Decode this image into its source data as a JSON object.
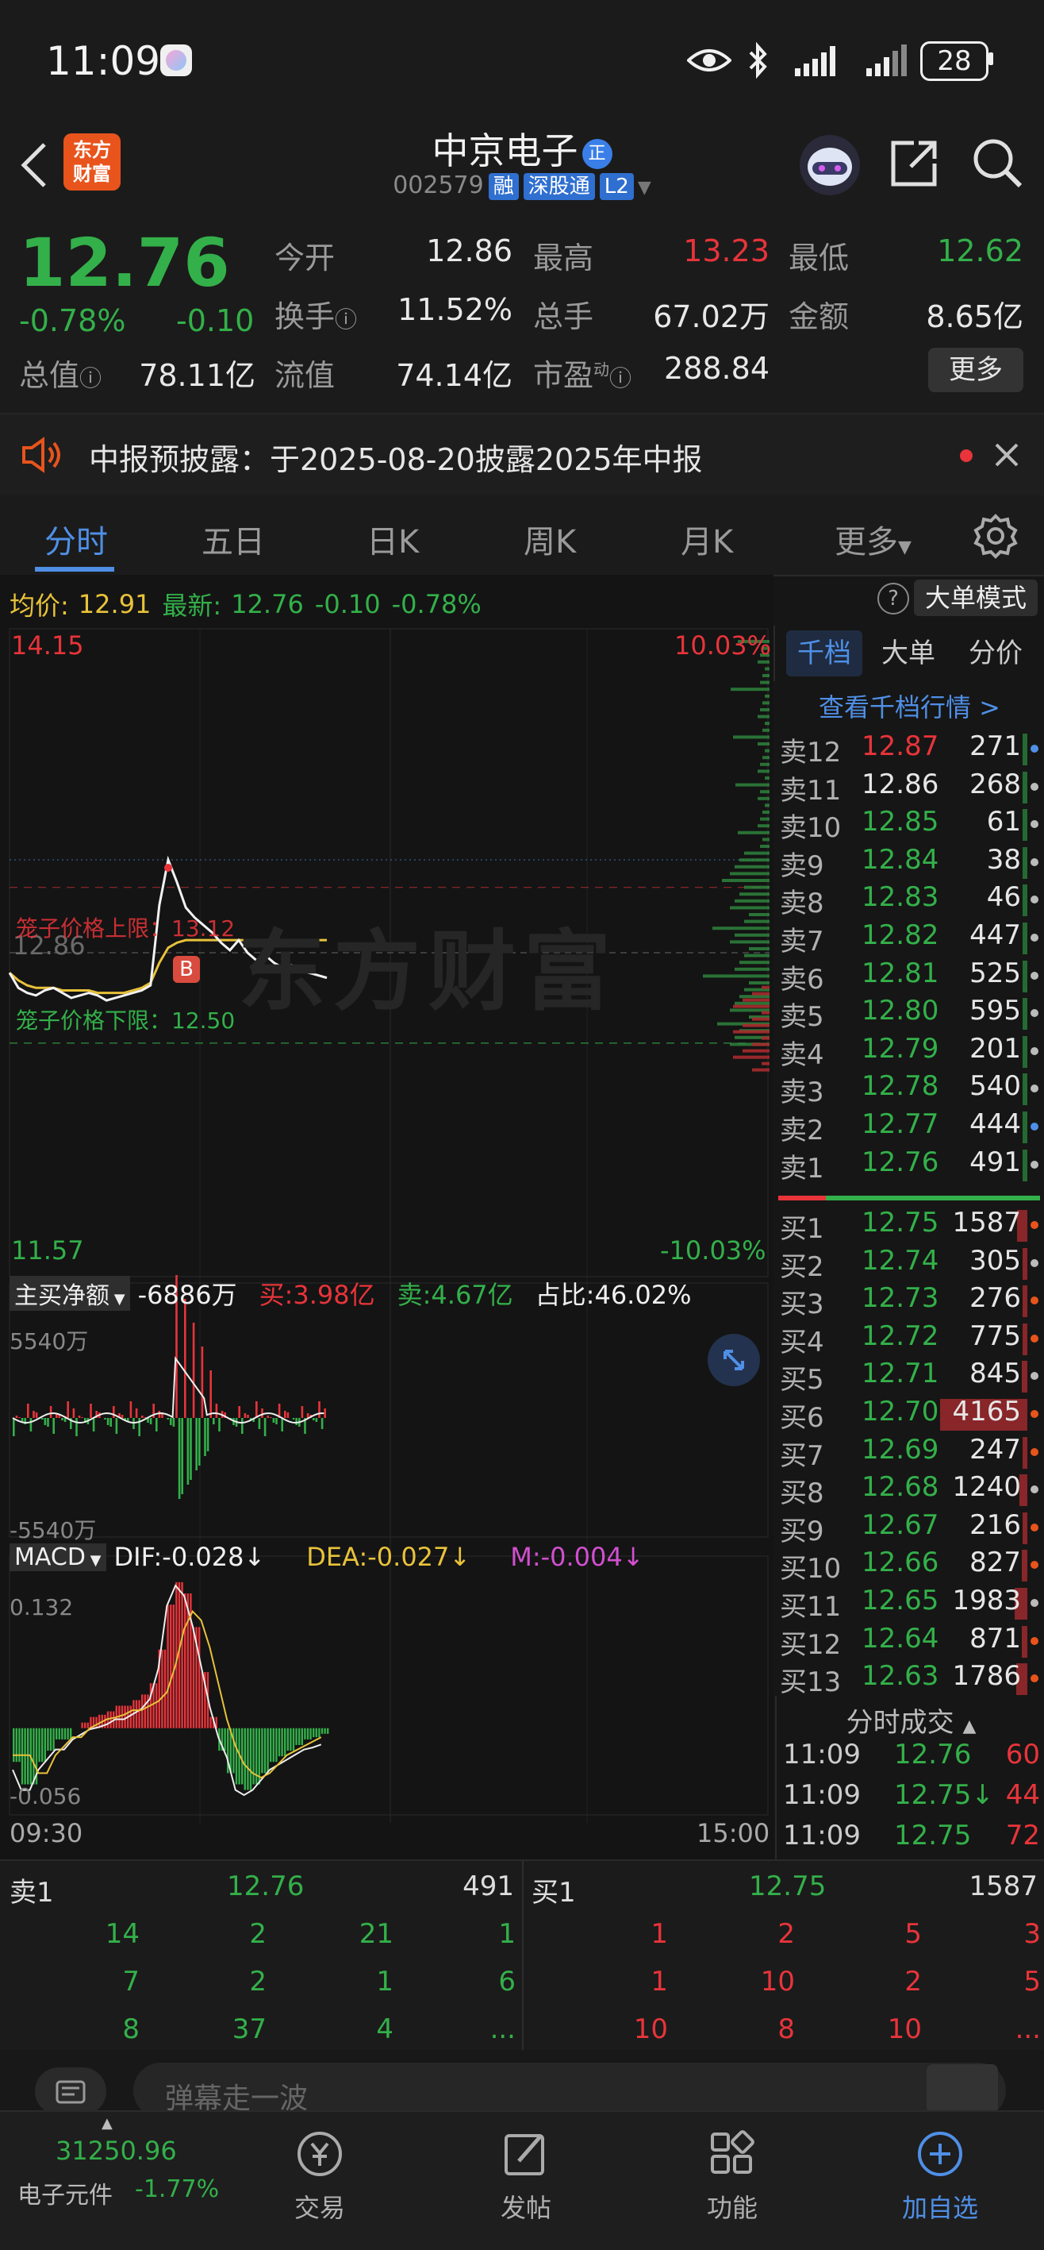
{
  "status": {
    "time": "11:09",
    "battery": "28"
  },
  "header": {
    "stock_name": "中京电子",
    "name_badge": "正",
    "code": "002579",
    "tags": [
      "融",
      "深股通",
      "L2"
    ],
    "logo_text_1": "东方",
    "logo_text_2": "财富"
  },
  "quote": {
    "price": "12.76",
    "change_pct": "-0.78%",
    "change": "-0.10",
    "open_label": "今开",
    "open": "12.86",
    "high_label": "最高",
    "high": "13.23",
    "low_label": "最低",
    "low": "12.62",
    "turnover_label": "换手",
    "turnover": "11.52%",
    "volume_label": "总手",
    "volume": "67.02万",
    "amount_label": "金额",
    "amount": "8.65亿",
    "mktcap_label": "总值",
    "mktcap": "78.11亿",
    "float_label": "流值",
    "float": "74.14亿",
    "pe_label": "市盈",
    "pe_sup": "动",
    "pe": "288.84",
    "more_button": "更多"
  },
  "notice": {
    "text": "中报预披露：于2025-08-20披露2025年中报"
  },
  "tabs": [
    "分时",
    "五日",
    "日K",
    "周K",
    "月K",
    "更多"
  ],
  "chart_header": {
    "avg_label": "均价:",
    "avg": "12.91",
    "latest_label": "最新:",
    "latest": "12.76",
    "chg": "-0.10",
    "pct": "-0.78%",
    "mode_button": "大单模式"
  },
  "chart_data": {
    "type": "line",
    "price_axis": {
      "top": "14.15",
      "bottom": "11.57",
      "top_pct": "10.03%",
      "bottom_pct": "-10.03%",
      "prev_close": "12.86"
    },
    "upper_limit_label": "笼子价格上限：13.12",
    "lower_limit_label": "笼子价格下限：12.50",
    "upper_limit": 13.12,
    "lower_limit": 12.5,
    "time_start": "09:30",
    "time_end": "15:00",
    "watermark": "东方财富",
    "price_series": [
      12.78,
      12.72,
      12.7,
      12.69,
      12.71,
      12.72,
      12.7,
      12.68,
      12.69,
      12.7,
      12.69,
      12.67,
      12.68,
      12.69,
      12.7,
      12.71,
      12.73,
      13.05,
      13.23,
      13.14,
      13.04,
      13.0,
      12.97,
      12.94,
      12.9,
      12.87,
      12.91,
      12.86,
      12.83,
      12.85,
      12.82,
      12.8,
      12.81,
      12.79,
      12.78,
      12.77,
      12.76
    ],
    "avg_series": [
      12.78,
      12.75,
      12.73,
      12.72,
      12.72,
      12.72,
      12.71,
      12.71,
      12.71,
      12.71,
      12.7,
      12.7,
      12.7,
      12.7,
      12.71,
      12.72,
      12.74,
      12.82,
      12.88,
      12.9,
      12.91,
      12.91,
      12.91,
      12.91,
      12.91,
      12.91,
      12.91,
      12.91,
      12.91,
      12.91,
      12.91,
      12.91,
      12.91,
      12.91,
      12.91,
      12.91,
      12.91
    ],
    "flow": {
      "label": "主买净额",
      "net": "-6886万",
      "buy": "买:3.98亿",
      "sell": "卖:4.67亿",
      "ratio": "占比:46.02%",
      "top": "5540万",
      "bottom": "-5540万"
    },
    "macd": {
      "label": "MACD",
      "dif": "DIF:-0.028↓",
      "dea": "DEA:-0.027↓",
      "m": "M:-0.004↓",
      "top": "0.132",
      "bottom": "-0.056"
    },
    "macd_hist": [
      -0.03,
      -0.05,
      -0.05,
      -0.03,
      -0.02,
      -0.01,
      -0.01,
      0.0,
      0.005,
      0.01,
      0.012,
      0.015,
      0.02,
      0.02,
      0.025,
      0.03,
      0.04,
      0.07,
      0.11,
      0.13,
      0.12,
      0.09,
      0.05,
      0.01,
      -0.02,
      -0.04,
      -0.05,
      -0.055,
      -0.05,
      -0.04,
      -0.03,
      -0.025,
      -0.02,
      -0.015,
      -0.01,
      -0.008,
      -0.005
    ]
  },
  "rpanel": {
    "tabs": [
      "千档",
      "大单",
      "分价"
    ],
    "link": "查看千档行情 >",
    "asks": [
      {
        "label": "卖12",
        "price": "12.87",
        "vol": "271"
      },
      {
        "label": "卖11",
        "price": "12.86",
        "vol": "268"
      },
      {
        "label": "卖10",
        "price": "12.85",
        "vol": "61"
      },
      {
        "label": "卖9",
        "price": "12.84",
        "vol": "38"
      },
      {
        "label": "卖8",
        "price": "12.83",
        "vol": "46"
      },
      {
        "label": "卖7",
        "price": "12.82",
        "vol": "447"
      },
      {
        "label": "卖6",
        "price": "12.81",
        "vol": "525"
      },
      {
        "label": "卖5",
        "price": "12.80",
        "vol": "595"
      },
      {
        "label": "卖4",
        "price": "12.79",
        "vol": "201"
      },
      {
        "label": "卖3",
        "price": "12.78",
        "vol": "540"
      },
      {
        "label": "卖2",
        "price": "12.77",
        "vol": "444"
      },
      {
        "label": "卖1",
        "price": "12.76",
        "vol": "491"
      }
    ],
    "bids": [
      {
        "label": "买1",
        "price": "12.75",
        "vol": "1587"
      },
      {
        "label": "买2",
        "price": "12.74",
        "vol": "305"
      },
      {
        "label": "买3",
        "price": "12.73",
        "vol": "276"
      },
      {
        "label": "买4",
        "price": "12.72",
        "vol": "775"
      },
      {
        "label": "买5",
        "price": "12.71",
        "vol": "845"
      },
      {
        "label": "买6",
        "price": "12.70",
        "vol": "4165"
      },
      {
        "label": "买7",
        "price": "12.69",
        "vol": "247"
      },
      {
        "label": "买8",
        "price": "12.68",
        "vol": "1240"
      },
      {
        "label": "买9",
        "price": "12.67",
        "vol": "216"
      },
      {
        "label": "买10",
        "price": "12.66",
        "vol": "827"
      },
      {
        "label": "买11",
        "price": "12.65",
        "vol": "1983"
      },
      {
        "label": "买12",
        "price": "12.64",
        "vol": "871"
      },
      {
        "label": "买13",
        "price": "12.63",
        "vol": "1786"
      }
    ],
    "trades_title": "分时成交",
    "trades": [
      {
        "time": "11:09",
        "price": "12.76",
        "vol": "60",
        "arrow": ""
      },
      {
        "time": "11:09",
        "price": "12.75",
        "vol": "44",
        "arrow": "↓"
      },
      {
        "time": "11:09",
        "price": "12.75",
        "vol": "72",
        "arrow": ""
      }
    ]
  },
  "btable": {
    "left_label": "卖1",
    "left_price": "12.76",
    "left_vol": "491",
    "right_label": "买1",
    "right_price": "12.75",
    "right_vol": "1587",
    "left_rows": [
      [
        "14",
        "2",
        "21",
        "1"
      ],
      [
        "7",
        "2",
        "1",
        "6"
      ],
      [
        "8",
        "37",
        "4",
        "..."
      ]
    ],
    "right_rows": [
      [
        "1",
        "2",
        "5",
        "3"
      ],
      [
        "1",
        "10",
        "2",
        "5"
      ],
      [
        "10",
        "8",
        "10",
        "..."
      ]
    ]
  },
  "comment": {
    "placeholder": "弹幕走一波"
  },
  "bnav": {
    "index_value": "31250.96",
    "index_name": "电子元件",
    "index_pct": "-1.77%",
    "items": [
      "交易",
      "发帖",
      "功能",
      "加自选"
    ]
  },
  "colors": {
    "red": "#e8343a",
    "green": "#33b04a",
    "yellow": "#e8c23a",
    "blue": "#4f8fe6"
  }
}
